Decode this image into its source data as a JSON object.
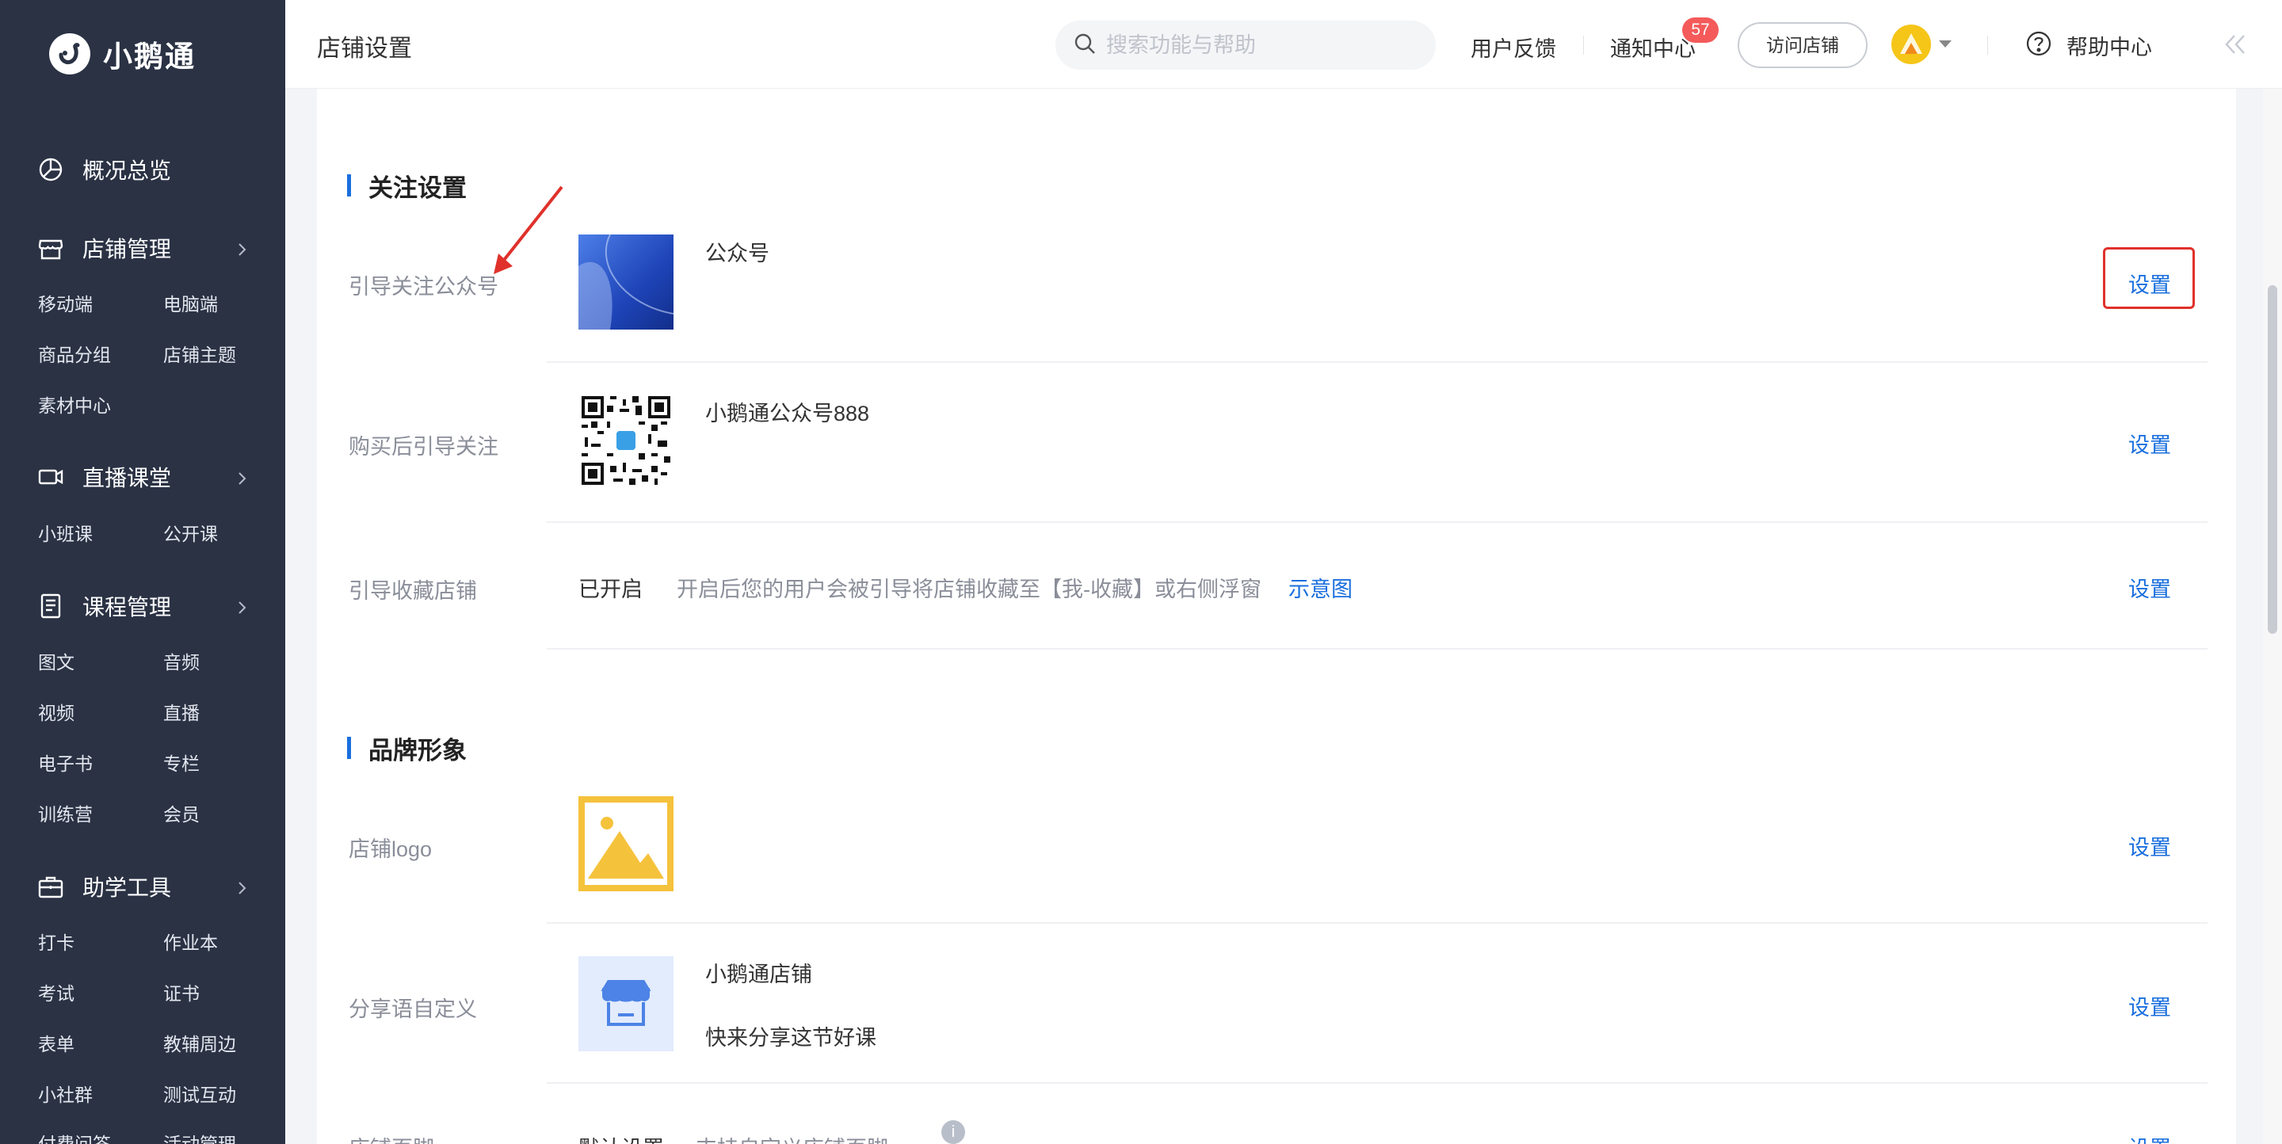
{
  "app": {
    "name": "小鹅通"
  },
  "sidebar": {
    "groups": [
      {
        "label": "概况总览",
        "icon": "pie-chart-icon",
        "items": []
      },
      {
        "label": "店铺管理",
        "icon": "store-icon",
        "items": [
          "移动端",
          "电脑端",
          "商品分组",
          "店铺主题",
          "素材中心"
        ]
      },
      {
        "label": "直播课堂",
        "icon": "video-camera-icon",
        "items": [
          "小班课",
          "公开课"
        ]
      },
      {
        "label": "课程管理",
        "icon": "document-icon",
        "items": [
          "图文",
          "音频",
          "视频",
          "直播",
          "电子书",
          "专栏",
          "训练营",
          "会员"
        ]
      },
      {
        "label": "助学工具",
        "icon": "toolbox-icon",
        "items": [
          "打卡",
          "作业本",
          "考试",
          "证书",
          "表单",
          "教辅周边",
          "小社群",
          "测试互动",
          "付费问答",
          "活动管理"
        ]
      }
    ]
  },
  "header": {
    "title": "店铺设置",
    "search_placeholder": "搜索功能与帮助",
    "feedback": "用户反馈",
    "notifications": "通知中心",
    "notification_count": "57",
    "visit_store": "访问店铺",
    "help": "帮助中心"
  },
  "follow_section": {
    "title": "关注设置",
    "rows": [
      {
        "label": "引导关注公众号",
        "name": "公众号",
        "action": "设置"
      },
      {
        "label": "购买后引导关注",
        "name": "小鹅通公众号888",
        "action": "设置"
      },
      {
        "label": "引导收藏店铺",
        "status": "已开启",
        "desc": "开启后您的用户会被引导将店铺收藏至【我-收藏】或右侧浮窗",
        "link": "示意图",
        "action": "设置"
      }
    ]
  },
  "brand_section": {
    "title": "品牌形象",
    "rows": [
      {
        "label": "店铺logo",
        "action": "设置"
      },
      {
        "label": "分享语自定义",
        "name": "小鹅通店铺",
        "desc": "快来分享这节好课",
        "action": "设置"
      },
      {
        "label": "店铺页脚",
        "status": "默认设置",
        "desc": "支持自定义店铺页脚",
        "action": "设置"
      }
    ]
  },
  "colors": {
    "accent": "#1a6fde",
    "sidebar_bg": "#2a3244",
    "highlight": "#e0312b",
    "badge": "#f45a5a"
  }
}
